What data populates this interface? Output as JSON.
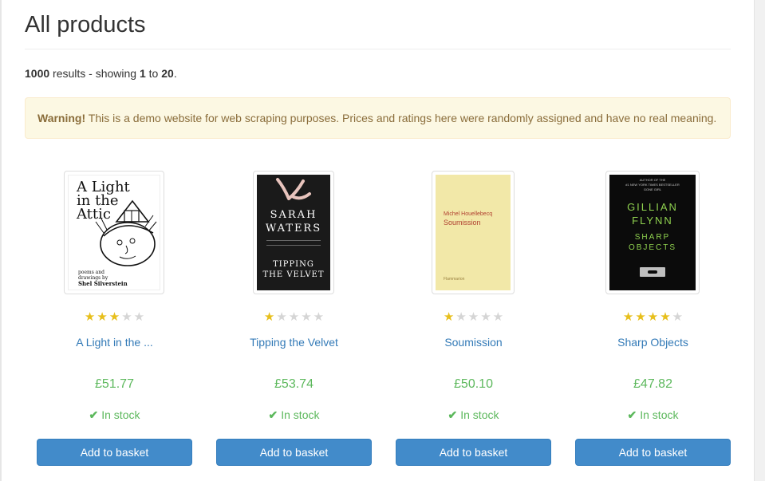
{
  "page": {
    "title": "All products"
  },
  "results": {
    "total": "1000",
    "text1": " results - showing ",
    "from": "1",
    "to_word": " to ",
    "to": "20",
    "end": "."
  },
  "alert": {
    "label": "Warning!",
    "message": " This is a demo website for web scraping purposes. Prices and ratings here were randomly assigned and have no real meaning."
  },
  "products": [
    {
      "title": "A Light in the ...",
      "price": "£51.77",
      "stock": "In stock",
      "button": "Add to basket",
      "rating": 3,
      "rating_of": 5,
      "cover": {
        "line1": "A Light",
        "line2": "in the",
        "line3": "Attic",
        "byline1": "poems and",
        "byline2": "drawings by",
        "author": "Shel Silverstein"
      }
    },
    {
      "title": "Tipping the Velvet",
      "price": "£53.74",
      "stock": "In stock",
      "button": "Add to basket",
      "rating": 1,
      "rating_of": 5,
      "cover": {
        "author1": "SARAH",
        "author2": "WATERS",
        "title1": "TIPPING",
        "title2": "THE VELVET"
      }
    },
    {
      "title": "Soumission",
      "price": "£50.10",
      "stock": "In stock",
      "button": "Add to basket",
      "rating": 1,
      "rating_of": 5,
      "cover": {
        "author": "Michel Houellebecq",
        "title": "Soumission",
        "publisher": "Flammarion"
      }
    },
    {
      "title": "Sharp Objects",
      "price": "£47.82",
      "stock": "In stock",
      "button": "Add to basket",
      "rating": 4,
      "rating_of": 5,
      "cover": {
        "tagline1": "AUTHOR OF THE",
        "tagline2": "#1 NEW YORK TIMES BESTSELLER",
        "tagline3": "GONE GIRL",
        "author1": "GILLIAN",
        "author2": "FLYNN",
        "title1": "SHARP",
        "title2": "OBJECTS"
      }
    }
  ],
  "icons": {
    "star": "star-icon",
    "check": "check-icon"
  },
  "colors": {
    "price": "#5cb85c",
    "link": "#337ab7",
    "button": "#428bca",
    "star_on": "#e7bf1c",
    "star_off": "#d5d5d5",
    "alert_bg": "#fcf8e3"
  }
}
